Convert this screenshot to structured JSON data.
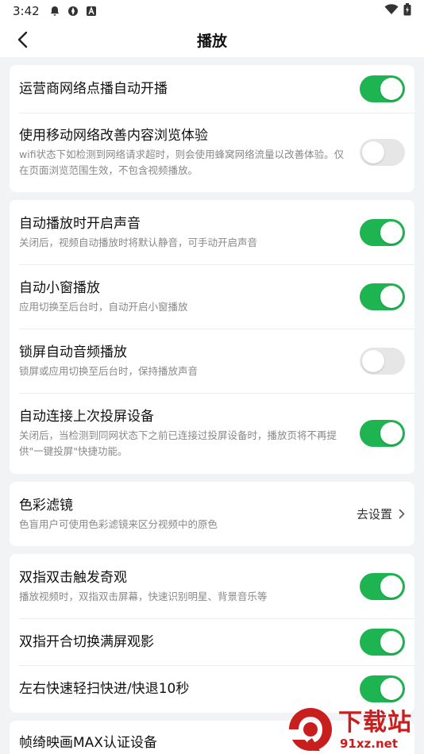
{
  "status_bar": {
    "time": "3:42"
  },
  "header": {
    "title": "播放"
  },
  "cards": [
    {
      "rows": [
        {
          "label": "运营商网络点播自动开播",
          "desc": "",
          "toggle": "on"
        },
        {
          "label": "使用移动网络改善内容浏览体验",
          "desc": "wifi状态下如检测到网络请求超时，则会使用蜂窝网络流量以改善体验。仅在页面浏览范围生效，不包含视频播放。",
          "toggle": "off"
        }
      ]
    },
    {
      "rows": [
        {
          "label": "自动播放时开启声音",
          "desc": "关闭后，视频自动播放时将默认静音，可手动开启声音",
          "toggle": "on"
        },
        {
          "label": "自动小窗播放",
          "desc": "应用切换至后台时，自动开启小窗播放",
          "toggle": "on"
        },
        {
          "label": "锁屏自动音频播放",
          "desc": "锁屏或应用切换至后台时，保持播放声音",
          "toggle": "off"
        },
        {
          "label": "自动连接上次投屏设备",
          "desc": "关闭后，当检测到同网状态下之前已连接过投屏设备时，播放页将不再提供\"一键投屏\"快捷功能。",
          "toggle": "on"
        }
      ]
    },
    {
      "rows": [
        {
          "label": "色彩滤镜",
          "desc": "色盲用户可使用色彩滤镜来区分视频中的原色",
          "link": "去设置"
        }
      ]
    },
    {
      "rows": [
        {
          "label": "双指双击触发奇观",
          "desc": "播放视频时，双指双击屏幕，快速识别明星、背景音乐等",
          "toggle": "on"
        },
        {
          "label": "双指开合切换满屏观影",
          "desc": "",
          "toggle": "on"
        },
        {
          "label": "左右快速轻扫快进/快退10秒",
          "desc": "",
          "toggle": "on"
        }
      ]
    },
    {
      "rows": [
        {
          "label": "帧绮映画MAX认证设备",
          "desc": ""
        }
      ]
    }
  ],
  "watermark": {
    "title": "下载站",
    "url": "91xz.net"
  },
  "colors": {
    "toggle_on": "#1fb452",
    "toggle_off": "#e6e6e6",
    "background": "#f2f3f5"
  }
}
